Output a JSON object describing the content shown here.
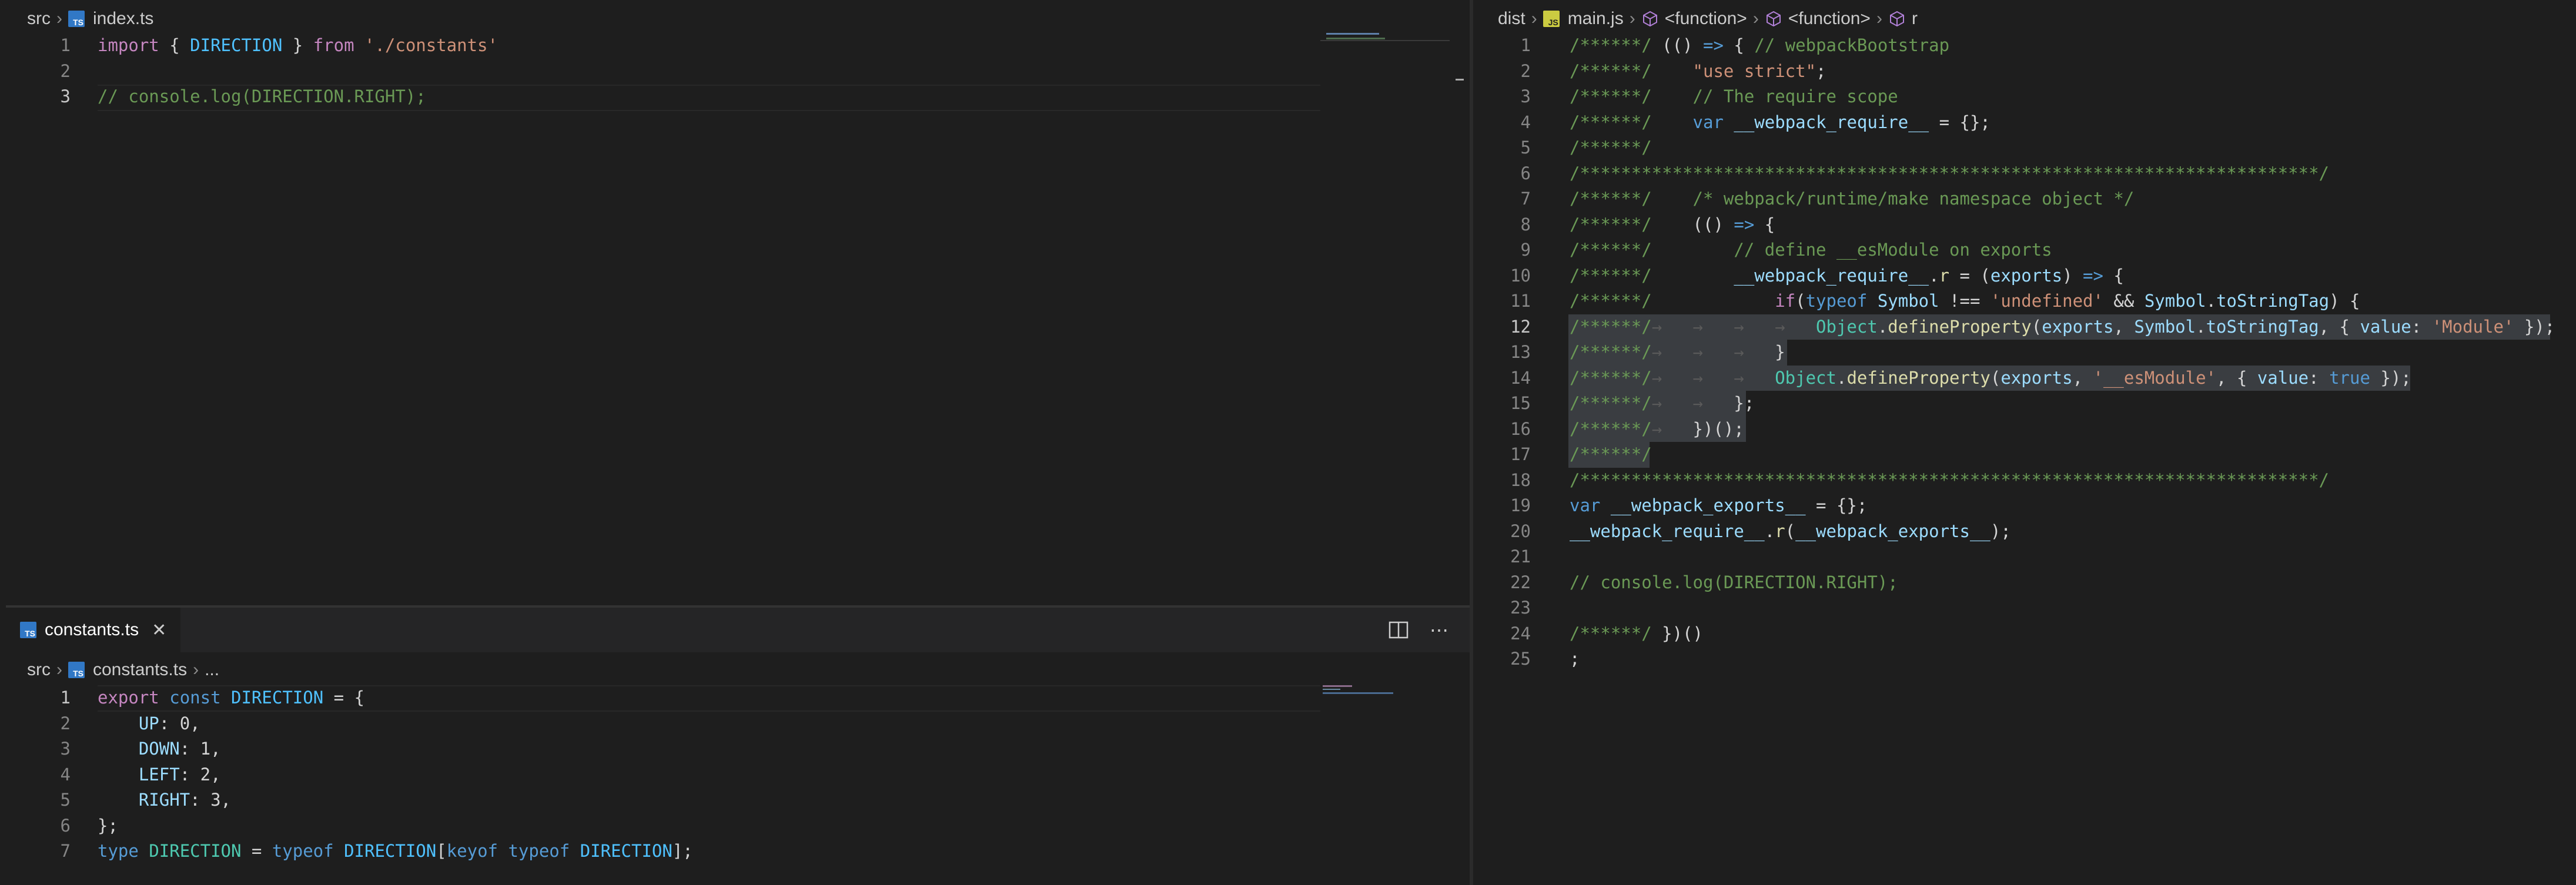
{
  "left_top": {
    "breadcrumb": [
      "src",
      "index.ts"
    ],
    "lines": [
      {
        "n": "1",
        "tokens": [
          [
            "import",
            "kwc"
          ],
          [
            " { ",
            "pl"
          ],
          [
            "DIRECTION",
            "cst"
          ],
          [
            " } ",
            "pl"
          ],
          [
            "from",
            "kwc"
          ],
          [
            " ",
            "pl"
          ],
          [
            "'./constants'",
            "str"
          ]
        ]
      },
      {
        "n": "2",
        "tokens": []
      },
      {
        "n": "3",
        "tokens": [
          [
            "// console.log(DIRECTION.RIGHT);",
            "cmt"
          ]
        ]
      }
    ],
    "active_line": "3"
  },
  "left_bottom": {
    "tab": {
      "label": "constants.ts",
      "close": "✕"
    },
    "actions": {
      "split": "split-editor-icon",
      "more": "⋯"
    },
    "breadcrumb": [
      "src",
      "constants.ts",
      "..."
    ],
    "lines": [
      {
        "n": "1",
        "tokens": [
          [
            "export",
            "kwc"
          ],
          [
            " ",
            "pl"
          ],
          [
            "const",
            "kw"
          ],
          [
            " ",
            "pl"
          ],
          [
            "DIRECTION",
            "cst"
          ],
          [
            " = {",
            "pl"
          ]
        ]
      },
      {
        "n": "2",
        "tokens": [
          [
            "    ",
            "pl"
          ],
          [
            "UP",
            "var"
          ],
          [
            ": ",
            "pl"
          ],
          [
            "0",
            "pl"
          ],
          [
            ",",
            "pl"
          ]
        ]
      },
      {
        "n": "3",
        "tokens": [
          [
            "    ",
            "pl"
          ],
          [
            "DOWN",
            "var"
          ],
          [
            ": ",
            "pl"
          ],
          [
            "1",
            "pl"
          ],
          [
            ",",
            "pl"
          ]
        ]
      },
      {
        "n": "4",
        "tokens": [
          [
            "    ",
            "pl"
          ],
          [
            "LEFT",
            "var"
          ],
          [
            ": ",
            "pl"
          ],
          [
            "2",
            "pl"
          ],
          [
            ",",
            "pl"
          ]
        ]
      },
      {
        "n": "5",
        "tokens": [
          [
            "    ",
            "pl"
          ],
          [
            "RIGHT",
            "var"
          ],
          [
            ": ",
            "pl"
          ],
          [
            "3",
            "pl"
          ],
          [
            ",",
            "pl"
          ]
        ]
      },
      {
        "n": "6",
        "tokens": [
          [
            "};",
            "pl"
          ]
        ]
      },
      {
        "n": "7",
        "tokens": [
          [
            "type",
            "kw"
          ],
          [
            " ",
            "pl"
          ],
          [
            "DIRECTION",
            "ty"
          ],
          [
            " = ",
            "pl"
          ],
          [
            "typeof",
            "kw"
          ],
          [
            " ",
            "pl"
          ],
          [
            "DIRECTION",
            "cst"
          ],
          [
            "[",
            "pl"
          ],
          [
            "keyof",
            "kw"
          ],
          [
            " ",
            "pl"
          ],
          [
            "typeof",
            "kw"
          ],
          [
            " ",
            "pl"
          ],
          [
            "DIRECTION",
            "cst"
          ],
          [
            "];",
            "pl"
          ]
        ]
      }
    ],
    "active_line": "1"
  },
  "right": {
    "breadcrumb": [
      "dist",
      "main.js",
      "<function>",
      "<function>",
      "r"
    ],
    "lines": [
      {
        "n": "1",
        "tokens": [
          [
            "/******/",
            "cmt"
          ],
          [
            " (() ",
            "pl"
          ],
          [
            "=>",
            "kw"
          ],
          [
            " { ",
            "pl"
          ],
          [
            "// webpackBootstrap",
            "cmt"
          ]
        ]
      },
      {
        "n": "2",
        "tokens": [
          [
            "/******/",
            "cmt"
          ],
          [
            "    ",
            "pl"
          ],
          [
            "\"use strict\"",
            "str"
          ],
          [
            ";",
            "pl"
          ]
        ]
      },
      {
        "n": "3",
        "tokens": [
          [
            "/******/",
            "cmt"
          ],
          [
            "    ",
            "pl"
          ],
          [
            "// The require scope",
            "cmt"
          ]
        ]
      },
      {
        "n": "4",
        "tokens": [
          [
            "/******/",
            "cmt"
          ],
          [
            "    ",
            "pl"
          ],
          [
            "var",
            "kw"
          ],
          [
            " ",
            "pl"
          ],
          [
            "__webpack_require__",
            "var"
          ],
          [
            " = {};",
            "pl"
          ]
        ]
      },
      {
        "n": "5",
        "tokens": [
          [
            "/******/",
            "cmt"
          ]
        ]
      },
      {
        "n": "6",
        "tokens": [
          [
            "/************************************************************************/",
            "cmt"
          ]
        ]
      },
      {
        "n": "7",
        "tokens": [
          [
            "/******/",
            "cmt"
          ],
          [
            "    ",
            "pl"
          ],
          [
            "/* webpack/runtime/make namespace object */",
            "cmt"
          ]
        ]
      },
      {
        "n": "8",
        "tokens": [
          [
            "/******/",
            "cmt"
          ],
          [
            "    (() ",
            "pl"
          ],
          [
            "=>",
            "kw"
          ],
          [
            " {",
            "pl"
          ]
        ]
      },
      {
        "n": "9",
        "tokens": [
          [
            "/******/",
            "cmt"
          ],
          [
            "        ",
            "pl"
          ],
          [
            "// define __esModule on exports",
            "cmt"
          ]
        ]
      },
      {
        "n": "10",
        "tokens": [
          [
            "/******/",
            "cmt"
          ],
          [
            "        ",
            "pl"
          ],
          [
            "__webpack_require__",
            "var"
          ],
          [
            ".",
            "pl"
          ],
          [
            "r",
            "fn"
          ],
          [
            " = (",
            "pl"
          ],
          [
            "exports",
            "var"
          ],
          [
            ") ",
            "pl"
          ],
          [
            "=>",
            "kw"
          ],
          [
            " {",
            "pl"
          ]
        ]
      },
      {
        "n": "11",
        "tokens": [
          [
            "/******/",
            "cmt"
          ],
          [
            "            ",
            "pl"
          ],
          [
            "if",
            "kwc"
          ],
          [
            "(",
            "pl"
          ],
          [
            "typeof",
            "kw"
          ],
          [
            " ",
            "pl"
          ],
          [
            "Symbol",
            "var"
          ],
          [
            " !== ",
            "pl"
          ],
          [
            "'undefined'",
            "str"
          ],
          [
            " && ",
            "pl"
          ],
          [
            "Symbol",
            "var"
          ],
          [
            ".",
            "pl"
          ],
          [
            "toStringTag",
            "var"
          ],
          [
            ") {",
            "pl"
          ]
        ]
      },
      {
        "n": "12",
        "tokens": [
          [
            "/******/",
            "cmt"
          ],
          [
            "→   →   →   →   ",
            "ws"
          ],
          [
            "Object",
            "ty"
          ],
          [
            ".",
            "pl"
          ],
          [
            "defineProperty",
            "fn"
          ],
          [
            "(",
            "pl"
          ],
          [
            "exports",
            "var"
          ],
          [
            ", ",
            "pl"
          ],
          [
            "Symbol",
            "var"
          ],
          [
            ".",
            "pl"
          ],
          [
            "toStringTag",
            "var"
          ],
          [
            ", { ",
            "pl"
          ],
          [
            "value",
            "var"
          ],
          [
            ": ",
            "pl"
          ],
          [
            "'Module'",
            "str"
          ],
          [
            " });",
            "pl"
          ]
        ]
      },
      {
        "n": "13",
        "tokens": [
          [
            "/******/",
            "cmt"
          ],
          [
            "→   →   →   ",
            "ws"
          ],
          [
            "}",
            "pl"
          ]
        ]
      },
      {
        "n": "14",
        "tokens": [
          [
            "/******/",
            "cmt"
          ],
          [
            "→   →   →   ",
            "ws"
          ],
          [
            "Object",
            "ty"
          ],
          [
            ".",
            "pl"
          ],
          [
            "defineProperty",
            "fn"
          ],
          [
            "(",
            "pl"
          ],
          [
            "exports",
            "var"
          ],
          [
            ", ",
            "pl"
          ],
          [
            "'__esModule'",
            "str"
          ],
          [
            ", { ",
            "pl"
          ],
          [
            "value",
            "var"
          ],
          [
            ": ",
            "pl"
          ],
          [
            "true",
            "kw"
          ],
          [
            " });",
            "pl"
          ]
        ]
      },
      {
        "n": "15",
        "tokens": [
          [
            "/******/",
            "cmt"
          ],
          [
            "→   →   ",
            "ws"
          ],
          [
            "};",
            "pl"
          ]
        ]
      },
      {
        "n": "16",
        "tokens": [
          [
            "/******/",
            "cmt"
          ],
          [
            "→   ",
            "ws"
          ],
          [
            "})();",
            "pl"
          ]
        ]
      },
      {
        "n": "17",
        "tokens": [
          [
            "/******/",
            "cmt"
          ]
        ]
      },
      {
        "n": "18",
        "tokens": [
          [
            "/************************************************************************/",
            "cmt"
          ]
        ]
      },
      {
        "n": "19",
        "tokens": [
          [
            "var",
            "kw"
          ],
          [
            " ",
            "pl"
          ],
          [
            "__webpack_exports__",
            "var"
          ],
          [
            " = {};",
            "pl"
          ]
        ]
      },
      {
        "n": "20",
        "tokens": [
          [
            "__webpack_require__",
            "var"
          ],
          [
            ".",
            "pl"
          ],
          [
            "r",
            "fn"
          ],
          [
            "(",
            "pl"
          ],
          [
            "__webpack_exports__",
            "var"
          ],
          [
            ");",
            "pl"
          ]
        ]
      },
      {
        "n": "21",
        "tokens": []
      },
      {
        "n": "22",
        "tokens": [
          [
            "// console.log(DIRECTION.RIGHT);",
            "cmt"
          ]
        ]
      },
      {
        "n": "23",
        "tokens": []
      },
      {
        "n": "24",
        "tokens": [
          [
            "/******/",
            "cmt"
          ],
          [
            " })()",
            "pl"
          ]
        ]
      },
      {
        "n": "25",
        "tokens": [
          [
            ";",
            "pl"
          ]
        ]
      }
    ],
    "active_line": "12",
    "selection": [
      "12",
      "13",
      "14",
      "15",
      "16",
      "17"
    ]
  }
}
